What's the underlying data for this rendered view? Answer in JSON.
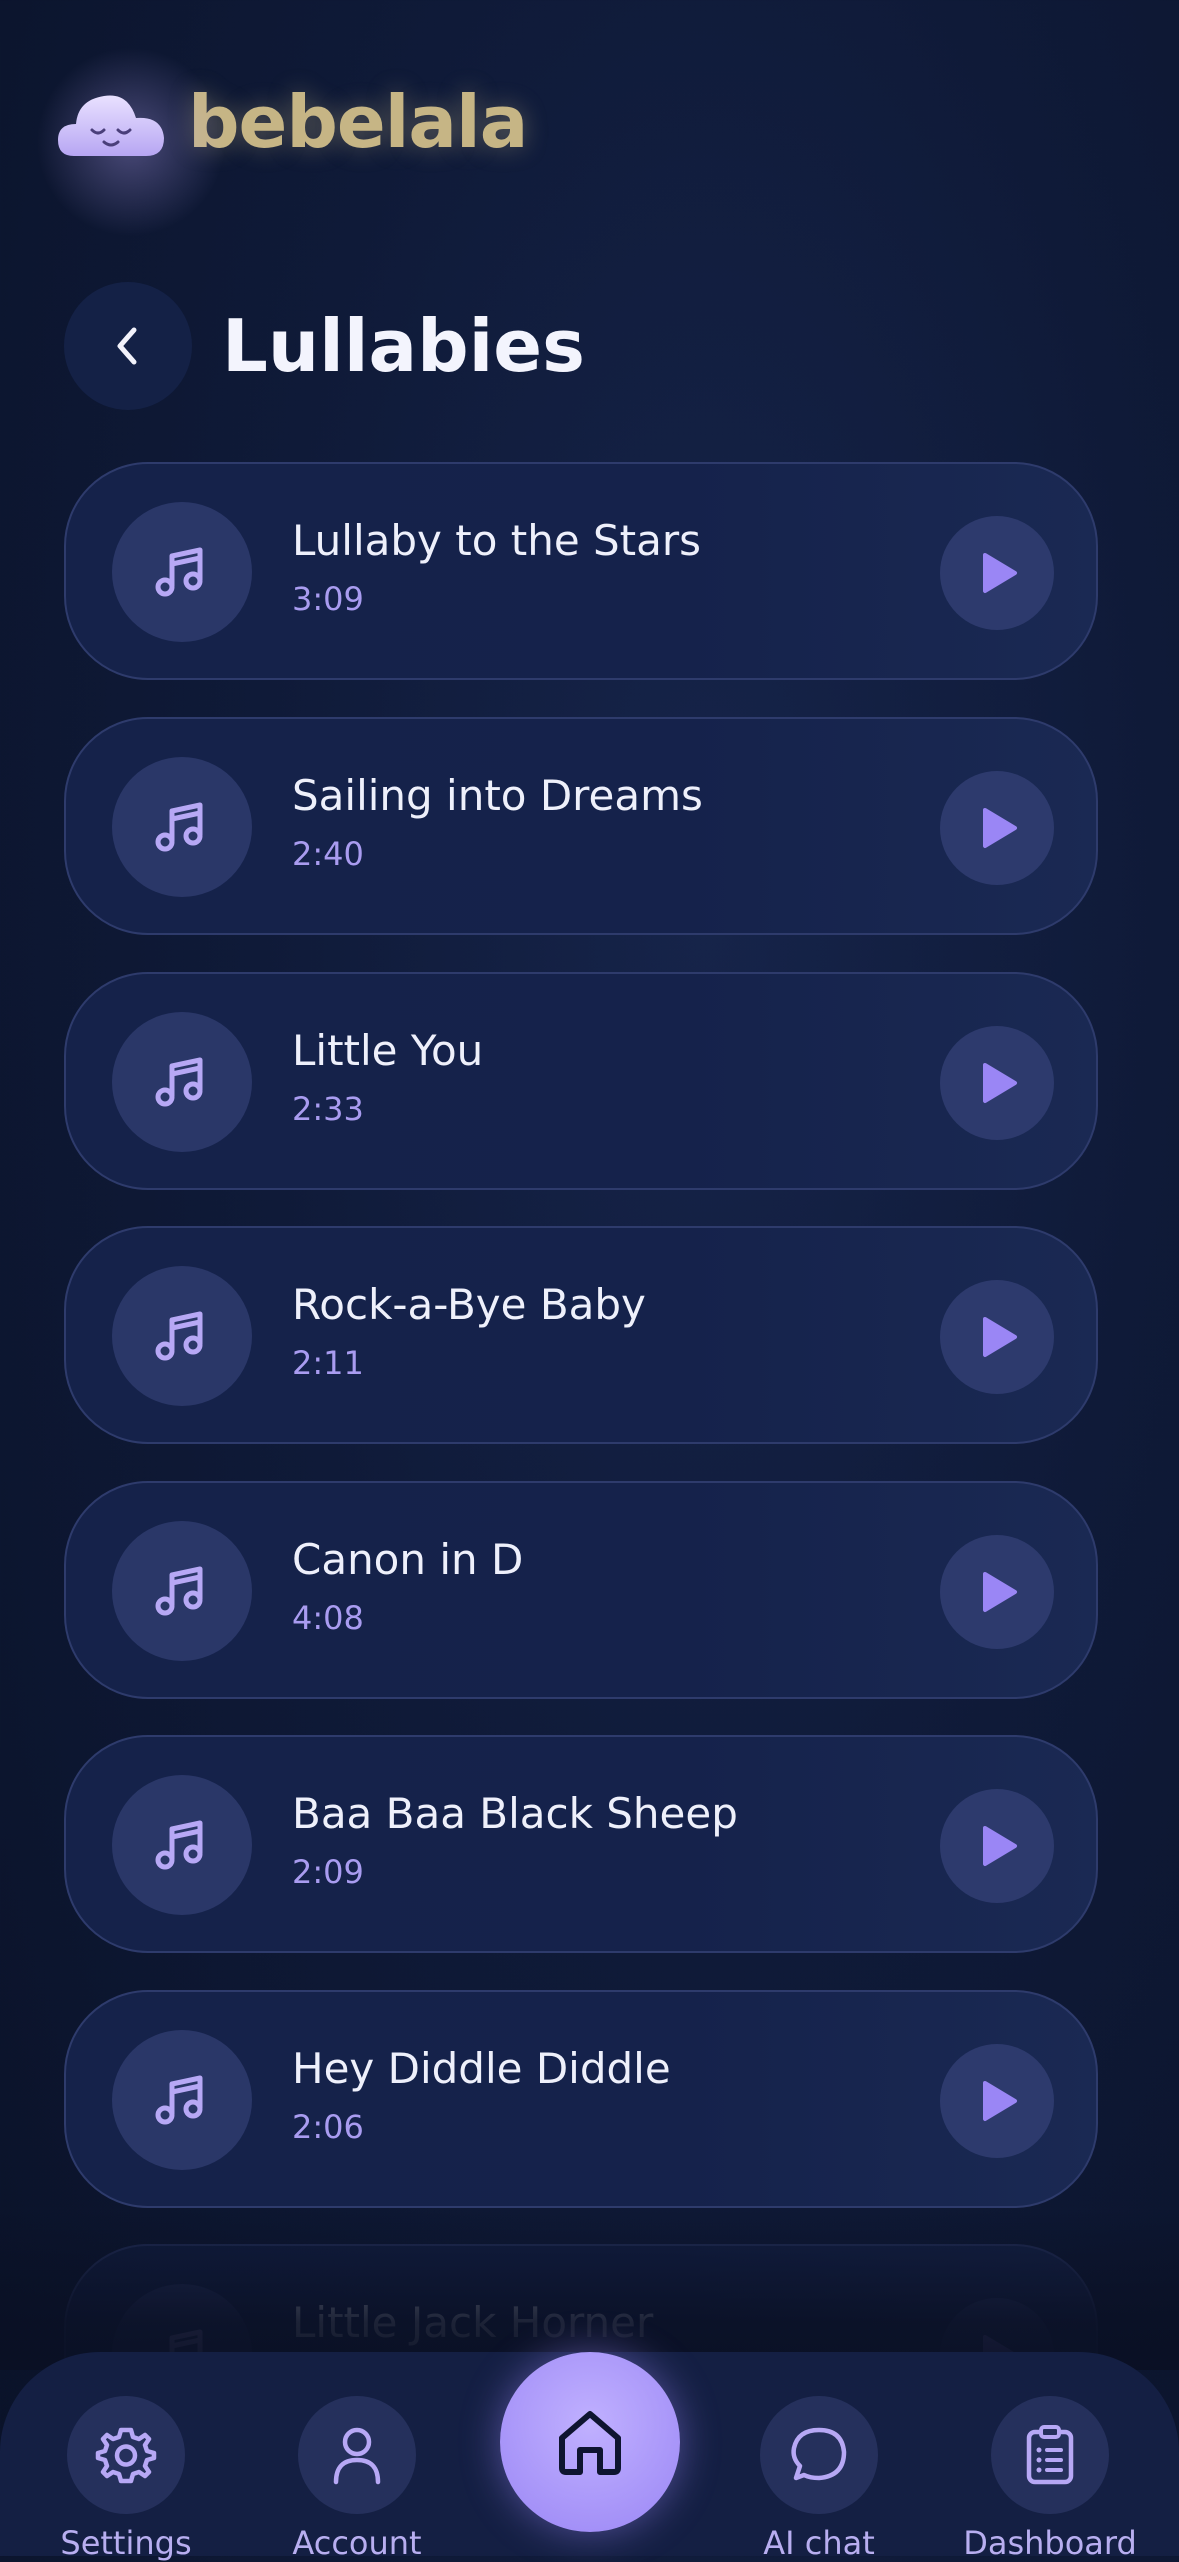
{
  "app": {
    "brand": "bebelala"
  },
  "header": {
    "title": "Lullabies"
  },
  "songs": [
    {
      "title": "Lullaby to the Stars",
      "duration": "3:09"
    },
    {
      "title": "Sailing into Dreams",
      "duration": "2:40"
    },
    {
      "title": "Little You",
      "duration": "2:33"
    },
    {
      "title": "Rock-a-Bye Baby",
      "duration": "2:11"
    },
    {
      "title": "Canon in D",
      "duration": "4:08"
    },
    {
      "title": "Baa Baa Black Sheep",
      "duration": "2:09"
    },
    {
      "title": "Hey Diddle Diddle",
      "duration": "2:06"
    },
    {
      "title": "Little Jack Horner",
      "duration": ""
    }
  ],
  "nav": {
    "settings": "Settings",
    "account": "Account",
    "ai_chat": "AI chat",
    "dashboard": "Dashboard"
  },
  "colors": {
    "accent": "#9a86f5",
    "brand_text": "#c6b585",
    "background": "#0f1a38"
  },
  "icons": {
    "back": "chevron-left-icon",
    "song": "music-note-icon",
    "play": "play-icon",
    "settings": "gear-icon",
    "account": "user-icon",
    "home": "home-icon",
    "ai_chat": "chat-bubble-icon",
    "dashboard": "clipboard-icon"
  }
}
